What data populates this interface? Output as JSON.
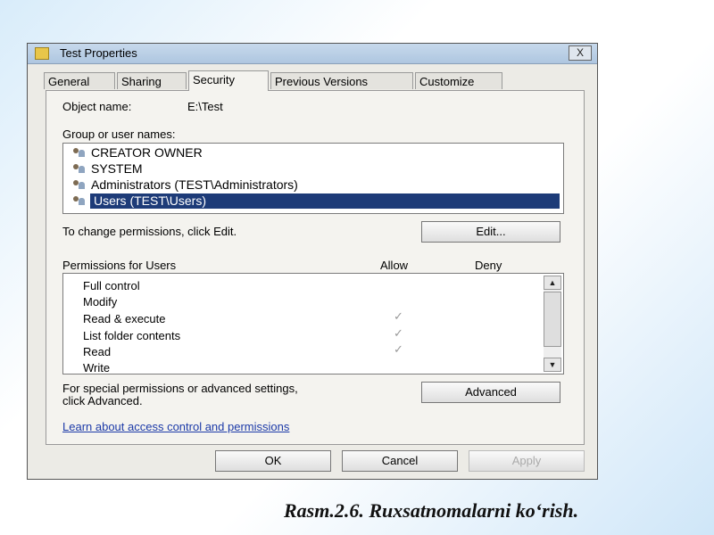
{
  "window": {
    "title": "Test Properties",
    "close_label": "X"
  },
  "tabs": [
    {
      "label": "General"
    },
    {
      "label": "Sharing"
    },
    {
      "label": "Security"
    },
    {
      "label": "Previous Versions"
    },
    {
      "label": "Customize"
    }
  ],
  "security": {
    "object_name_label": "Object name:",
    "object_name_value": "E:\\Test",
    "group_label": "Group or user names:",
    "users": [
      {
        "name": "CREATOR OWNER"
      },
      {
        "name": "SYSTEM"
      },
      {
        "name": "Administrators (TEST\\Administrators)"
      },
      {
        "name": "Users (TEST\\Users)"
      }
    ],
    "change_hint": "To change permissions, click Edit.",
    "edit_label": "Edit...",
    "permissions_label": "Permissions for Users",
    "allow_label": "Allow",
    "deny_label": "Deny",
    "permissions": [
      {
        "name": "Full control"
      },
      {
        "name": "Modify"
      },
      {
        "name": "Read & execute"
      },
      {
        "name": "List folder contents"
      },
      {
        "name": "Read"
      },
      {
        "name": "Write"
      }
    ],
    "check_glyph": "✓",
    "special_hint_1": "For special permissions or advanced settings,",
    "special_hint_2": "click Advanced.",
    "advanced_label": "Advanced",
    "learn_link": "Learn about access control and permissions"
  },
  "footer": {
    "ok_label": "OK",
    "cancel_label": "Cancel",
    "apply_label": "Apply"
  },
  "caption": "Rasm.2.6. Ruxsatnomalarni ko‘rish."
}
